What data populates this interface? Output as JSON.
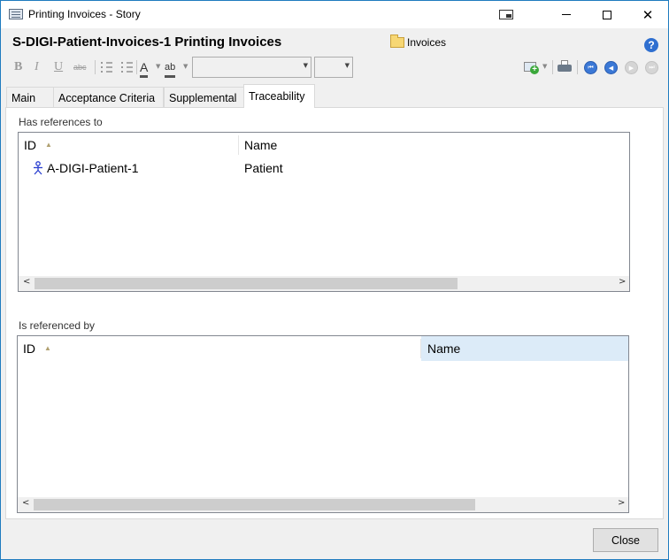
{
  "window": {
    "title": "Printing Invoices - Story",
    "controls": {
      "screen": "screen-icon",
      "minimize": "minimize-icon",
      "maximize": "maximize-icon",
      "close": "✕"
    }
  },
  "header": {
    "title": "S-DIGI-Patient-Invoices-1 Printing Invoices",
    "folder": "Invoices",
    "help": "?"
  },
  "toolbar": {
    "bold": "B",
    "italic": "I",
    "underline": "U",
    "strike": "abc",
    "font_color": "A",
    "highlight": "ab",
    "font_family_value": "",
    "font_size_value": ""
  },
  "tabs": [
    {
      "label": "Main",
      "active": false
    },
    {
      "label": "Acceptance Criteria",
      "active": false
    },
    {
      "label": "Supplemental",
      "active": false
    },
    {
      "label": "Traceability",
      "active": true
    }
  ],
  "has_references": {
    "label": "Has references to",
    "columns": [
      "ID",
      "Name"
    ],
    "rows": [
      {
        "id": "A-DIGI-Patient-1",
        "name": "Patient",
        "icon": "actor-icon"
      }
    ]
  },
  "referenced_by": {
    "label": "Is referenced by",
    "columns": [
      "ID",
      "Name"
    ],
    "rows": []
  },
  "footer": {
    "close_label": "Close"
  },
  "colors": {
    "window_border": "#1f7bbf",
    "selected_header": "#dcebf8",
    "nav_active": "#3b78d6"
  }
}
